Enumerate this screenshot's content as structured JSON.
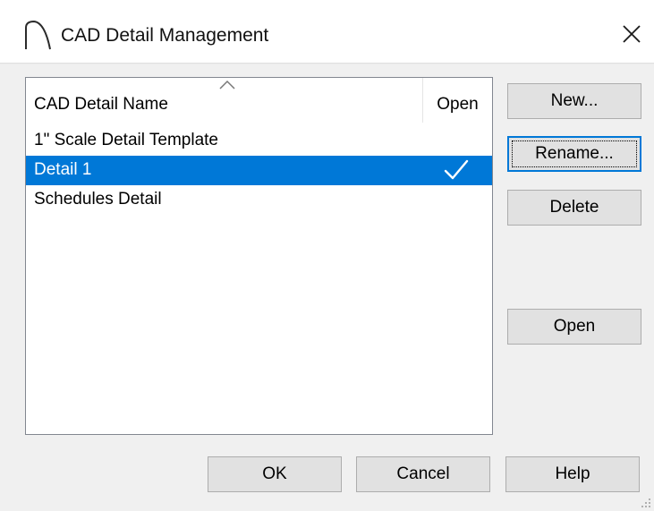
{
  "window": {
    "title": "CAD Detail Management",
    "close_icon": "close-icon",
    "app_icon": "arc-icon"
  },
  "list": {
    "columns": [
      {
        "label": "CAD Detail Name",
        "sorted": "ascending"
      },
      {
        "label": "Open"
      }
    ],
    "rows": [
      {
        "name": "1\" Scale Detail Template",
        "open": false,
        "selected": false
      },
      {
        "name": "Detail 1",
        "open": true,
        "selected": true
      },
      {
        "name": "Schedules Detail",
        "open": false,
        "selected": false
      }
    ]
  },
  "side_buttons": {
    "new": "New...",
    "rename": "Rename...",
    "delete": "Delete",
    "open": "Open"
  },
  "footer_buttons": {
    "ok": "OK",
    "cancel": "Cancel",
    "help": "Help"
  },
  "colors": {
    "selection": "#0078d7",
    "focus_border": "#0078d7",
    "button_face": "#e1e1e1"
  }
}
